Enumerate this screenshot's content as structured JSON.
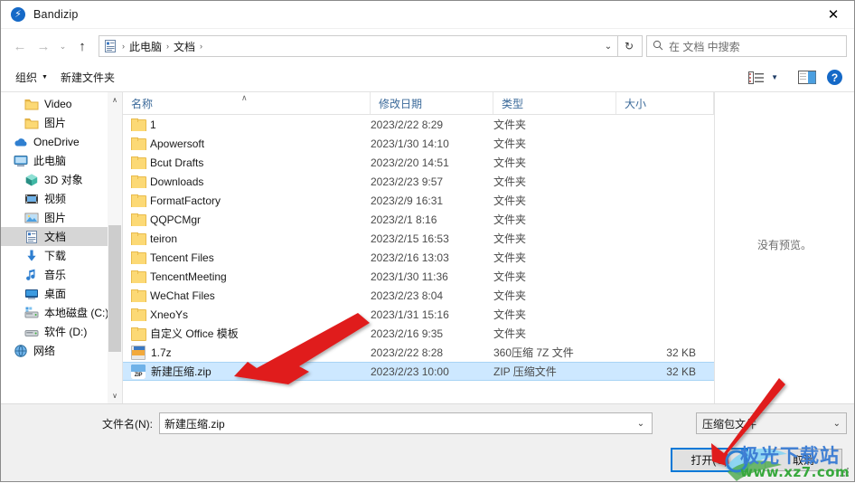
{
  "window": {
    "title": "Bandizip",
    "app_icon": "bandizip-lightning-icon",
    "close_label": "✕"
  },
  "addressbar": {
    "back_icon": "←",
    "forward_icon": "→",
    "recent_icon": "⌄",
    "up_icon": "↑",
    "path_icon": "documents-icon",
    "crumbs": [
      "此电脑",
      "文档"
    ],
    "separator": "›",
    "dropdown_icon": "⌄",
    "refresh_icon": "↻",
    "search_icon": "⚲",
    "search_placeholder": "在 文档 中搜索"
  },
  "commandbar": {
    "organize_label": "组织",
    "organize_caret": "▼",
    "new_folder_label": "新建文件夹",
    "view_caret": "▼",
    "help_label": "?"
  },
  "sidebar": {
    "items": [
      {
        "label": "Video",
        "icon": "folder-icon",
        "indent": 1,
        "selected": false
      },
      {
        "label": "图片",
        "icon": "folder-icon",
        "indent": 1,
        "selected": false
      },
      {
        "label": "OneDrive",
        "icon": "cloud-icon",
        "indent": 0,
        "selected": false
      },
      {
        "label": "此电脑",
        "icon": "computer-icon",
        "indent": 0,
        "selected": false
      },
      {
        "label": "3D 对象",
        "icon": "3d-objects-icon",
        "indent": 1,
        "selected": false
      },
      {
        "label": "视频",
        "icon": "videos-icon",
        "indent": 1,
        "selected": false
      },
      {
        "label": "图片",
        "icon": "pictures-icon",
        "indent": 1,
        "selected": false
      },
      {
        "label": "文档",
        "icon": "documents-icon",
        "indent": 1,
        "selected": true
      },
      {
        "label": "下载",
        "icon": "downloads-icon",
        "indent": 1,
        "selected": false
      },
      {
        "label": "音乐",
        "icon": "music-icon",
        "indent": 1,
        "selected": false
      },
      {
        "label": "桌面",
        "icon": "desktop-icon",
        "indent": 1,
        "selected": false
      },
      {
        "label": "本地磁盘 (C:)",
        "icon": "local-disk-icon",
        "indent": 1,
        "selected": false
      },
      {
        "label": "软件 (D:)",
        "icon": "disk-icon",
        "indent": 1,
        "selected": false
      },
      {
        "label": "网络",
        "icon": "network-icon",
        "indent": 0,
        "selected": false
      }
    ],
    "scroll_up_icon": "∧",
    "scroll_down_icon": "∨"
  },
  "filelist": {
    "columns": [
      "名称",
      "修改日期",
      "类型",
      "大小"
    ],
    "sort_indicator": "∧",
    "rows": [
      {
        "name": "1",
        "icon": "folder-icon",
        "date": "2023/2/22 8:29",
        "type": "文件夹",
        "size": "",
        "selected": false
      },
      {
        "name": "Apowersoft",
        "icon": "folder-icon",
        "date": "2023/1/30 14:10",
        "type": "文件夹",
        "size": "",
        "selected": false
      },
      {
        "name": "Bcut Drafts",
        "icon": "folder-icon",
        "date": "2023/2/20 14:51",
        "type": "文件夹",
        "size": "",
        "selected": false
      },
      {
        "name": "Downloads",
        "icon": "folder-icon",
        "date": "2023/2/23 9:57",
        "type": "文件夹",
        "size": "",
        "selected": false
      },
      {
        "name": "FormatFactory",
        "icon": "folder-icon",
        "date": "2023/2/9 16:31",
        "type": "文件夹",
        "size": "",
        "selected": false
      },
      {
        "name": "QQPCMgr",
        "icon": "folder-icon",
        "date": "2023/2/1 8:16",
        "type": "文件夹",
        "size": "",
        "selected": false
      },
      {
        "name": "teiron",
        "icon": "folder-icon",
        "date": "2023/2/15 16:53",
        "type": "文件夹",
        "size": "",
        "selected": false
      },
      {
        "name": "Tencent Files",
        "icon": "folder-icon",
        "date": "2023/2/16 13:03",
        "type": "文件夹",
        "size": "",
        "selected": false
      },
      {
        "name": "TencentMeeting",
        "icon": "folder-icon",
        "date": "2023/1/30 11:36",
        "type": "文件夹",
        "size": "",
        "selected": false
      },
      {
        "name": "WeChat Files",
        "icon": "folder-icon",
        "date": "2023/2/23 8:04",
        "type": "文件夹",
        "size": "",
        "selected": false
      },
      {
        "name": "XneoYs",
        "icon": "folder-icon",
        "date": "2023/1/31 15:16",
        "type": "文件夹",
        "size": "",
        "selected": false
      },
      {
        "name": "自定义 Office 模板",
        "icon": "folder-icon",
        "date": "2023/2/16 9:35",
        "type": "文件夹",
        "size": "",
        "selected": false
      },
      {
        "name": "1.7z",
        "icon": "sevenzip-icon",
        "date": "2023/2/22 8:28",
        "type": "360压缩 7Z 文件",
        "size": "32 KB",
        "selected": false
      },
      {
        "name": "新建压缩.zip",
        "icon": "zip-icon",
        "date": "2023/2/23 10:00",
        "type": "ZIP 压缩文件",
        "size": "32 KB",
        "selected": true
      }
    ]
  },
  "preview": {
    "text": "没有预览。"
  },
  "bottom": {
    "filename_label": "文件名(N):",
    "filename_value": "新建压缩.zip",
    "filename_caret": "⌄",
    "filetype_value": "压缩包文件",
    "filetype_caret": "⌄",
    "open_label": "打开(O)",
    "cancel_label": "取消"
  },
  "watermark": {
    "top_text": "极光下载站",
    "bottom_text": "www.xz7.com"
  },
  "colors": {
    "accent": "#0078d7",
    "selection": "#cde8ff",
    "brand_blue": "#1569c7",
    "arrow_red": "#e01b1b",
    "watermark_blue": "#3f7fd4",
    "watermark_green": "#37a83c"
  }
}
